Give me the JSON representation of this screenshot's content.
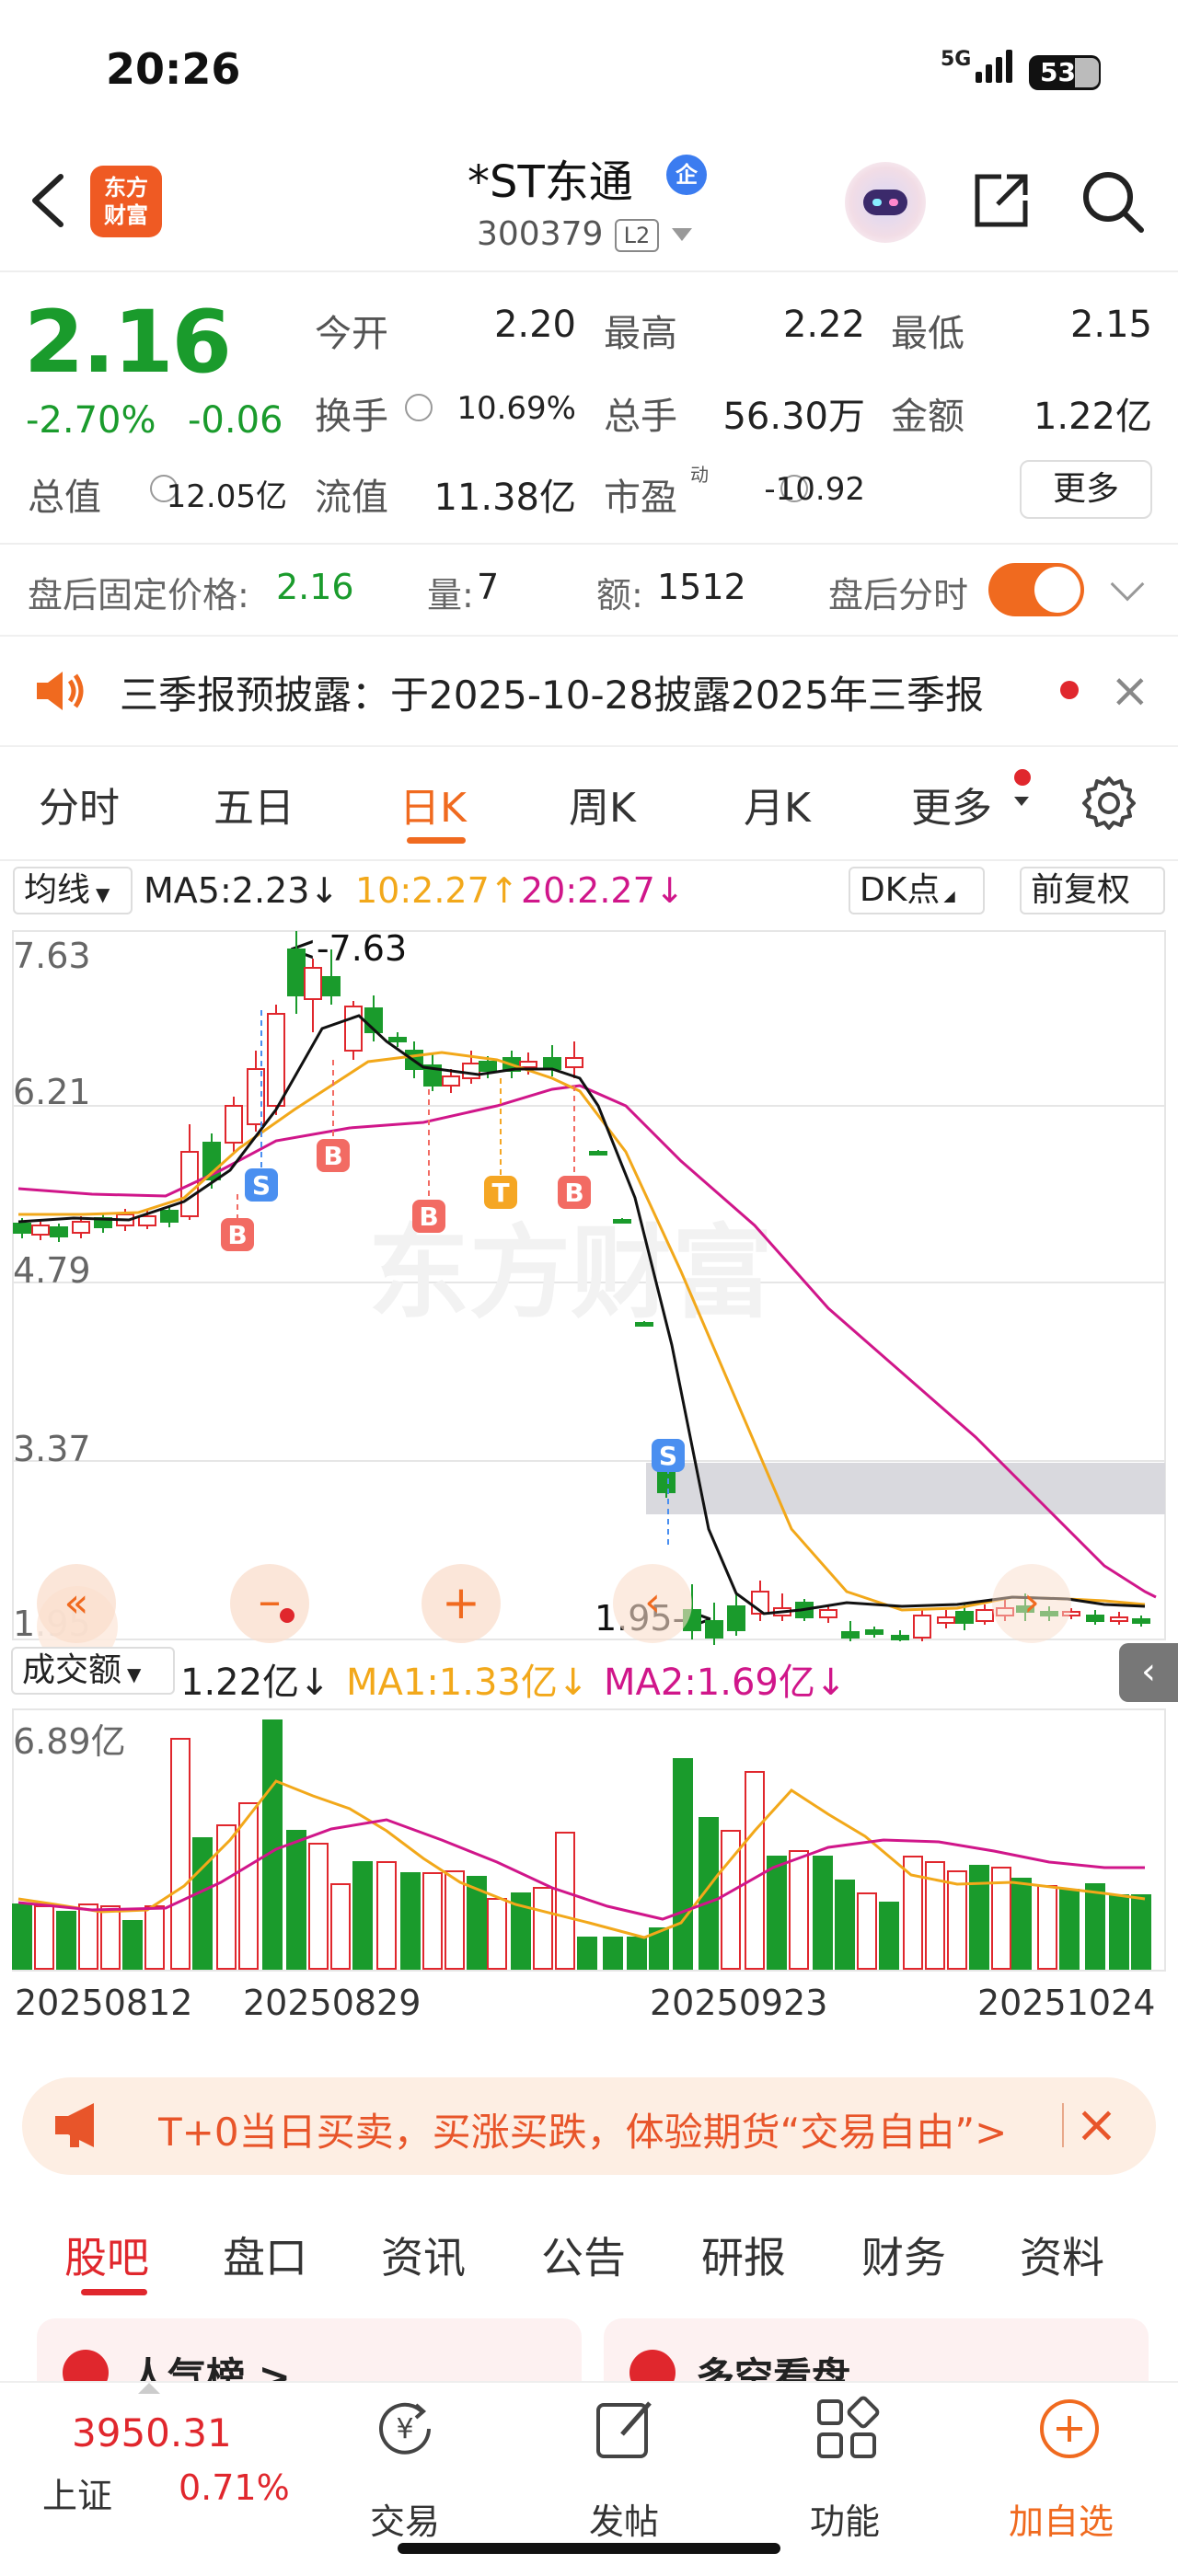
{
  "status": {
    "time": "20:26",
    "network": "5G",
    "battery": "53"
  },
  "header": {
    "brand_line1": "东方",
    "brand_line2": "财富",
    "title": "*ST东通",
    "qi_badge": "企",
    "code": "300379",
    "level": "L2"
  },
  "quote": {
    "price": "2.16",
    "change_pct": "-2.70%",
    "change_val": "-0.06",
    "open_label": "今开",
    "open": "2.20",
    "high_label": "最高",
    "high": "2.22",
    "low_label": "最低",
    "low": "2.15",
    "turnover_label": "换手",
    "turnover": "10.69%",
    "volume_label": "总手",
    "volume": "56.30万",
    "amount_label": "金额",
    "amount": "1.22亿",
    "mktcap_label": "总值",
    "mktcap": "12.05亿",
    "float_label": "流值",
    "float": "11.38亿",
    "pe_label": "市盈",
    "pe_sup": "动",
    "pe": "-10.92",
    "more": "更多"
  },
  "afterhours": {
    "label": "盘后固定价格:",
    "price": "2.16",
    "vol_label": "量:",
    "vol": "7",
    "amt_label": "额:",
    "amt": "1512",
    "toggle_label": "盘后分时"
  },
  "notice": {
    "text": "三季报预披露：于2025-10-28披露2025年三季报"
  },
  "tabs": [
    "分时",
    "五日",
    "日K",
    "周K",
    "月K",
    "更多"
  ],
  "ma": {
    "selector": "均线",
    "ma5": "MA5:2.23↓",
    "ma10": "10:2.27↑",
    "ma20": "20:2.27↓",
    "dk": "DK点",
    "adjust": "前复权"
  },
  "colors": {
    "up": "#e0272d",
    "down": "#1a9b2c",
    "ma5": "#111111",
    "ma10": "#f2a81a",
    "ma20": "#d0168a",
    "accent": "#f06a1f"
  },
  "chart_data": {
    "type": "candlestick",
    "y_ticks": [
      "7.63",
      "6.21",
      "4.79",
      "3.37",
      "1.95"
    ],
    "max_label": "<-7.63",
    "min_label": "1.95->",
    "markers": [
      "B",
      "S",
      "B",
      "B",
      "T",
      "B",
      "S"
    ],
    "watermark": "东方财富"
  },
  "volume": {
    "selector": "成交额",
    "value": "1.22亿↓",
    "ma1": "MA1:1.33亿↓",
    "ma2": "MA2:1.69亿↓",
    "max_label": "6.89亿",
    "dates": [
      "20250812",
      "20250829",
      "20250923",
      "20251024"
    ]
  },
  "promo": {
    "text": "T+0当日买卖，买涨买跌，体验期货“交易自由”>"
  },
  "bottom_tabs": [
    "股吧",
    "盘口",
    "资讯",
    "公告",
    "研报",
    "财务",
    "资料"
  ],
  "cards": [
    "人气榜 >",
    "多空看盘"
  ],
  "nav": {
    "index_value": "3950.31",
    "index_name": "上证",
    "index_pct": "0.71%",
    "items": [
      "交易",
      "发帖",
      "功能",
      "加自选"
    ]
  }
}
